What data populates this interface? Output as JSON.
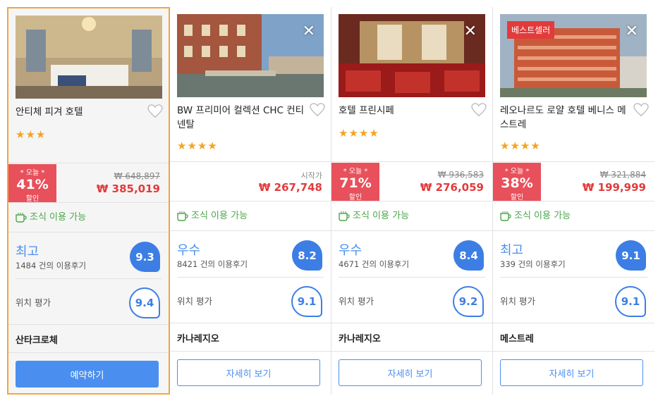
{
  "hotels": [
    {
      "name": "안티체 피겨 호텔",
      "stars": "★★★",
      "discount": {
        "label": "* 오늘 *",
        "percent": "41%",
        "sub": "할인"
      },
      "old_price": "₩ 648,897",
      "price": "₩ 385,019",
      "breakfast": "조식 이용 가능",
      "rating_word": "최고",
      "reviews": "1484 건의 이용후기",
      "score": "9.3",
      "location_label": "위치 평가",
      "location_score": "9.4",
      "district": "산타크로체",
      "button": "예약하기"
    },
    {
      "name": "BW 프리미어 컬렉션 CHC 컨티넨탈",
      "stars": "★★★★",
      "price_prefix": "시작가",
      "price": "₩ 267,748",
      "breakfast": "조식 이용 가능",
      "rating_word": "우수",
      "reviews": "8421 건의 이용후기",
      "score": "8.2",
      "location_label": "위치 평가",
      "location_score": "9.1",
      "district": "카나레지오",
      "button": "자세히 보기",
      "close": "✕"
    },
    {
      "name": "호텔 프린시페",
      "stars": "★★★★",
      "discount": {
        "label": "* 오늘 *",
        "percent": "71%",
        "sub": "할인"
      },
      "old_price": "₩ 936,583",
      "price": "₩ 276,059",
      "breakfast": "조식 이용 가능",
      "rating_word": "우수",
      "reviews": "4671 건의 이용후기",
      "score": "8.4",
      "location_label": "위치 평가",
      "location_score": "9.2",
      "district": "카나레지오",
      "button": "자세히 보기",
      "close": "✕"
    },
    {
      "badge": "베스트셀러",
      "name": "레오나르도 로얄 호텔 베니스 메스트레",
      "stars": "★★★★",
      "discount": {
        "label": "* 오늘 *",
        "percent": "38%",
        "sub": "할인"
      },
      "old_price": "₩ 321,884",
      "price": "₩ 199,999",
      "breakfast": "조식 이용 가능",
      "rating_word": "최고",
      "reviews": "339 건의 이용후기",
      "score": "9.1",
      "location_label": "위치 평가",
      "location_score": "9.1",
      "district": "메스트레",
      "button": "자세히 보기",
      "close": "✕"
    }
  ],
  "colors": {
    "accent": "#4a8ff0",
    "price": "#e23b3b",
    "discount_bg": "#e8505b",
    "star": "#f5a31d",
    "breakfast": "#4aa64a",
    "selected_border": "#f4a53c"
  },
  "icons": {
    "heart": "heart-outline-icon",
    "cup": "coffee-cup-icon",
    "close": "close-icon"
  }
}
